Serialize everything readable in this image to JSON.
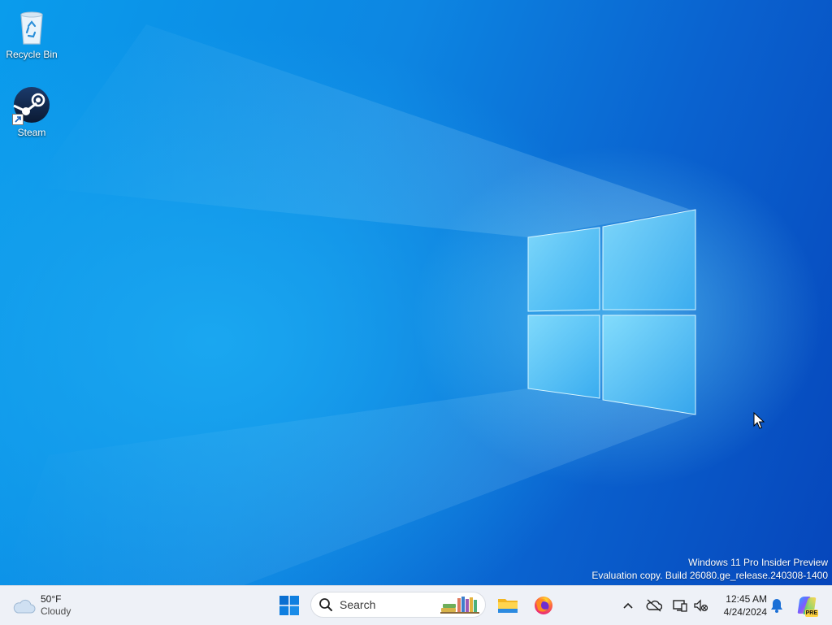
{
  "desktop": {
    "icons": [
      {
        "label": "Recycle Bin"
      },
      {
        "label": "Steam"
      }
    ],
    "watermark": {
      "line1": "Windows 11 Pro Insider Preview",
      "line2": "Evaluation copy. Build 26080.ge_release.240308-1400"
    }
  },
  "taskbar": {
    "weather": {
      "temp": "50°F",
      "condition": "Cloudy",
      "icon": "cloudy-icon"
    },
    "start": {
      "icon": "windows-logo-icon"
    },
    "search": {
      "placeholder": "Search"
    },
    "pinned": [
      {
        "icon": "file-explorer-icon"
      },
      {
        "icon": "firefox-icon"
      }
    ],
    "tray": {
      "icons": [
        "chevron-up-icon",
        "onedrive-offline-icon",
        "display-icon",
        "volume-muted-icon"
      ]
    },
    "clock": {
      "time": "12:45 AM",
      "date": "4/24/2024"
    },
    "notification_icon": "bell-icon",
    "copilot_badge": "PRE"
  },
  "colors": {
    "accent": "#0078d4",
    "taskbar_bg": "#eef1f7",
    "wallpaper_light": "#19b4f4",
    "wallpaper_dark": "#0646bb"
  }
}
